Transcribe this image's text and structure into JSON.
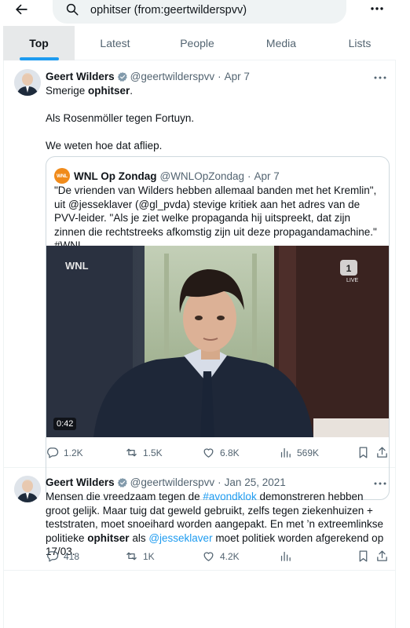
{
  "search": {
    "query": "ophitser (from:geertwilderspvv)"
  },
  "tabs": [
    {
      "label": "Top",
      "active": true
    },
    {
      "label": "Latest"
    },
    {
      "label": "People"
    },
    {
      "label": "Media"
    },
    {
      "label": "Lists"
    }
  ],
  "tweets": [
    {
      "author": "Geert Wilders",
      "handle": "@geertwilderspvv",
      "date": "Apr 7",
      "text": {
        "p1_pre": "Smerige ",
        "p1_bold": "ophitser",
        "p1_post": ".",
        "p2": "Als Rosenmöller tegen Fortuyn.",
        "p3": "We weten hoe dat afliep."
      },
      "quote": {
        "logo_text": "WNL",
        "name": "WNL Op Zondag",
        "handle": "@WNLOpZondag",
        "date": "Apr 7",
        "text": "\"De vrienden van Wilders hebben allemaal banden met het Kremlin\", uit @jesseklaver (@gl_pvda) stevige kritiek aan het adres van de PVV-leider. \"Als je ziet welke propaganda hij uitspreekt, dat zijn zinnen die rechtstreeks afkomstig zijn uit deze propagandamachine.\" #WNL",
        "video": {
          "watermark": "WNL",
          "channel": "NPO 1",
          "live": "LIVE",
          "duration": "0:42"
        }
      },
      "stats": {
        "replies": "1.2K",
        "reposts": "1.5K",
        "likes": "6.8K",
        "views": "569K"
      }
    },
    {
      "author": "Geert Wilders",
      "handle": "@geertwilderspvv",
      "date": "Jan 25, 2021",
      "text": {
        "s1": "Mensen die vreedzaam tegen de ",
        "hashtag": "#avondklok",
        "s2": " demonstreren hebben groot gelijk. Maar tuig dat geweld gebruikt, zelfs tegen ziekenhuizen + teststraten, moet snoeihard worden aangepakt. En met ’n extreemlinkse politieke ",
        "bold": "ophitser",
        "s3": " als ",
        "mention": "@jesseklaver",
        "s4": " moet politiek worden afgerekend op 17/03."
      },
      "stats": {
        "replies": "418",
        "reposts": "1K",
        "likes": "4.2K",
        "views": ""
      }
    }
  ],
  "colors": {
    "accent": "#1d9bf0",
    "text": "#0f1419",
    "muted": "#536471",
    "wnl_orange": "#f08b1b"
  }
}
